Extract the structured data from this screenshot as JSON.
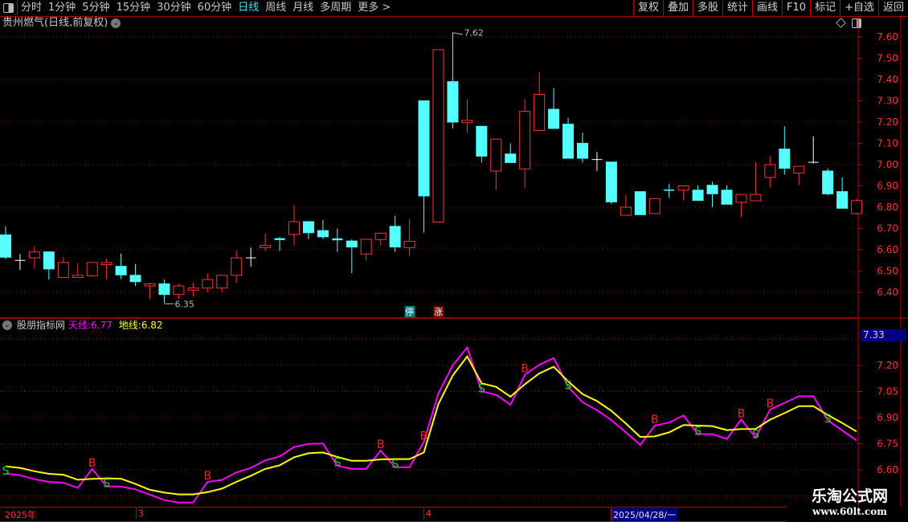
{
  "toolbar": {
    "tabs": [
      "分时",
      "1分钟",
      "5分钟",
      "15分钟",
      "30分钟",
      "60分钟",
      "日线",
      "周线",
      "月线",
      "多周期",
      "更多 >"
    ],
    "active_tab": "日线",
    "right_buttons": [
      "复权",
      "叠加",
      "多股",
      "统计",
      "画线",
      "F10",
      "标记",
      "+自选",
      "返回"
    ]
  },
  "main": {
    "title": "贵州燃气(日线,前复权)",
    "high_label": "7.62",
    "low_label": "6.35",
    "badge_stop": "停",
    "badge_rise": "涨",
    "axis_labels": [
      "7.60",
      "7.50",
      "7.40",
      "7.30",
      "7.20",
      "7.10",
      "7.00",
      "6.90",
      "6.80",
      "6.70",
      "6.60",
      "6.50",
      "6.40"
    ]
  },
  "indicator": {
    "name": "股朋指标网",
    "line1_label": "天线:",
    "line1_value": "6.77",
    "line2_label": "地线:",
    "line2_value": "6.82",
    "cursor_value": "7.33",
    "axis_labels": [
      "7.20",
      "7.05",
      "6.90",
      "6.75",
      "6.60"
    ]
  },
  "dates": {
    "year": "2025年",
    "m3": "3",
    "m4": "4",
    "cursor": "2025/04/28/一"
  },
  "watermark": {
    "cn": "乐淘公式网",
    "url": "www.60lt.com"
  },
  "colors": {
    "up": "#ff3232",
    "down": "#54ffff",
    "flat": "#ffffff",
    "tian": "#ff00ff",
    "di": "#ffff00",
    "buy": "#ff2020",
    "sell": "#00e000",
    "grid": "#a00000"
  },
  "chart_data": [
    {
      "type": "candlestick",
      "ylim": [
        6.35,
        7.65
      ],
      "grid": true,
      "ohlc": [
        [
          6.67,
          6.71,
          6.555,
          6.565
        ],
        [
          6.55,
          6.58,
          6.505,
          6.55
        ],
        [
          6.562,
          6.617,
          6.51,
          6.59
        ],
        [
          6.59,
          6.59,
          6.46,
          6.51
        ],
        [
          6.47,
          6.567,
          6.47,
          6.54
        ],
        [
          6.47,
          6.537,
          6.47,
          6.48
        ],
        [
          6.478,
          6.54,
          6.473,
          6.54
        ],
        [
          6.53,
          6.56,
          6.462,
          6.54
        ],
        [
          6.522,
          6.582,
          6.462,
          6.482
        ],
        [
          6.48,
          6.533,
          6.43,
          6.45
        ],
        [
          6.43,
          6.447,
          6.37,
          6.44
        ],
        [
          6.44,
          6.46,
          6.35,
          6.39
        ],
        [
          6.39,
          6.44,
          6.37,
          6.43
        ],
        [
          6.41,
          6.447,
          6.38,
          6.42
        ],
        [
          6.42,
          6.488,
          6.4,
          6.46
        ],
        [
          6.42,
          6.48,
          6.4,
          6.48
        ],
        [
          6.48,
          6.598,
          6.444,
          6.562
        ],
        [
          6.562,
          6.61,
          6.52,
          6.562
        ],
        [
          6.61,
          6.677,
          6.594,
          6.62
        ],
        [
          6.65,
          6.66,
          6.594,
          6.645
        ],
        [
          6.672,
          6.81,
          6.62,
          6.732
        ],
        [
          6.732,
          6.732,
          6.65,
          6.68
        ],
        [
          6.69,
          6.74,
          6.65,
          6.661
        ],
        [
          6.649,
          6.7,
          6.59,
          6.644
        ],
        [
          6.641,
          6.649,
          6.49,
          6.613
        ],
        [
          6.58,
          6.649,
          6.55,
          6.649
        ],
        [
          6.648,
          6.678,
          6.62,
          6.678
        ],
        [
          6.71,
          6.76,
          6.59,
          6.613
        ],
        [
          6.61,
          6.746,
          6.57,
          6.64
        ],
        [
          7.3,
          7.3,
          6.68,
          6.853
        ],
        [
          6.73,
          7.54,
          6.73,
          7.54
        ],
        [
          7.39,
          7.62,
          7.17,
          7.2
        ],
        [
          7.197,
          7.307,
          7.15,
          7.208
        ],
        [
          7.18,
          7.18,
          7.01,
          7.04
        ],
        [
          6.97,
          7.12,
          6.88,
          7.12
        ],
        [
          7.05,
          7.1,
          7.01,
          7.01
        ],
        [
          6.98,
          7.307,
          6.89,
          7.25
        ],
        [
          7.16,
          7.435,
          7.16,
          7.33
        ],
        [
          7.26,
          7.36,
          7.17,
          7.17
        ],
        [
          7.19,
          7.22,
          7.03,
          7.03
        ],
        [
          7.1,
          7.15,
          7.01,
          7.03
        ],
        [
          7.024,
          7.06,
          6.97,
          7.024
        ],
        [
          7.012,
          7.012,
          6.815,
          6.825
        ],
        [
          6.762,
          6.857,
          6.762,
          6.8
        ],
        [
          6.873,
          6.873,
          6.765,
          6.765
        ],
        [
          6.77,
          6.84,
          6.77,
          6.84
        ],
        [
          6.88,
          6.91,
          6.844,
          6.878
        ],
        [
          6.88,
          6.9,
          6.832,
          6.9
        ],
        [
          6.88,
          6.903,
          6.832,
          6.832
        ],
        [
          6.903,
          6.92,
          6.8,
          6.863
        ],
        [
          6.88,
          6.903,
          6.814,
          6.814
        ],
        [
          6.823,
          6.86,
          6.753,
          6.86
        ],
        [
          6.83,
          7.01,
          6.83,
          6.86
        ],
        [
          6.94,
          7.04,
          6.893,
          7.0
        ],
        [
          7.073,
          7.18,
          6.953,
          6.983
        ],
        [
          6.96,
          6.992,
          6.904,
          6.992
        ],
        [
          7.011,
          7.133,
          7.005,
          7.011
        ],
        [
          6.97,
          6.982,
          6.855,
          6.863
        ],
        [
          6.873,
          6.94,
          6.795,
          6.795
        ],
        [
          6.77,
          6.84,
          6.766,
          6.831
        ]
      ]
    },
    {
      "type": "line",
      "ylim": [
        6.55,
        7.33
      ],
      "grid": true,
      "series": [
        {
          "name": "天线",
          "values": [
            6.579,
            6.569,
            6.546,
            6.531,
            6.526,
            6.496,
            6.605,
            6.505,
            6.503,
            6.488,
            6.457,
            6.426,
            6.412,
            6.412,
            6.531,
            6.542,
            6.585,
            6.611,
            6.654,
            6.677,
            6.731,
            6.749,
            6.751,
            6.623,
            6.605,
            6.605,
            6.711,
            6.615,
            6.615,
            6.76,
            7.038,
            7.2,
            7.303,
            7.051,
            7.031,
            6.974,
            7.146,
            7.203,
            7.242,
            7.077,
            6.988,
            6.943,
            6.885,
            6.815,
            6.743,
            6.854,
            6.872,
            6.912,
            6.805,
            6.805,
            6.777,
            6.889,
            6.785,
            6.946,
            6.985,
            7.023,
            7.023,
            6.885,
            6.826,
            6.769
          ]
        },
        {
          "name": "地线",
          "values": [
            6.62,
            6.611,
            6.592,
            6.577,
            6.572,
            6.543,
            6.548,
            6.551,
            6.549,
            6.519,
            6.485,
            6.469,
            6.459,
            6.459,
            6.472,
            6.492,
            6.531,
            6.566,
            6.605,
            6.626,
            6.672,
            6.695,
            6.7,
            6.674,
            6.652,
            6.652,
            6.66,
            6.662,
            6.662,
            6.7,
            6.977,
            7.142,
            7.251,
            7.097,
            7.077,
            7.02,
            7.092,
            7.154,
            7.192,
            7.108,
            7.035,
            6.995,
            6.939,
            6.866,
            6.789,
            6.792,
            6.815,
            6.857,
            6.854,
            6.851,
            6.828,
            6.834,
            6.835,
            6.888,
            6.926,
            6.966,
            6.966,
            6.915,
            6.869,
            6.82
          ]
        }
      ],
      "signals": [
        {
          "i": 0,
          "t": "S"
        },
        {
          "i": 6,
          "t": "B"
        },
        {
          "i": 7,
          "t": "S"
        },
        {
          "i": 14,
          "t": "B"
        },
        {
          "i": 23,
          "t": "S"
        },
        {
          "i": 26,
          "t": "B"
        },
        {
          "i": 27,
          "t": "S"
        },
        {
          "i": 29,
          "t": "B"
        },
        {
          "i": 33,
          "t": "S"
        },
        {
          "i": 36,
          "t": "B"
        },
        {
          "i": 39,
          "t": "S"
        },
        {
          "i": 45,
          "t": "B"
        },
        {
          "i": 48,
          "t": "S"
        },
        {
          "i": 51,
          "t": "B"
        },
        {
          "i": 52,
          "t": "S"
        },
        {
          "i": 53,
          "t": "B"
        },
        {
          "i": 57,
          "t": "S"
        }
      ]
    }
  ]
}
